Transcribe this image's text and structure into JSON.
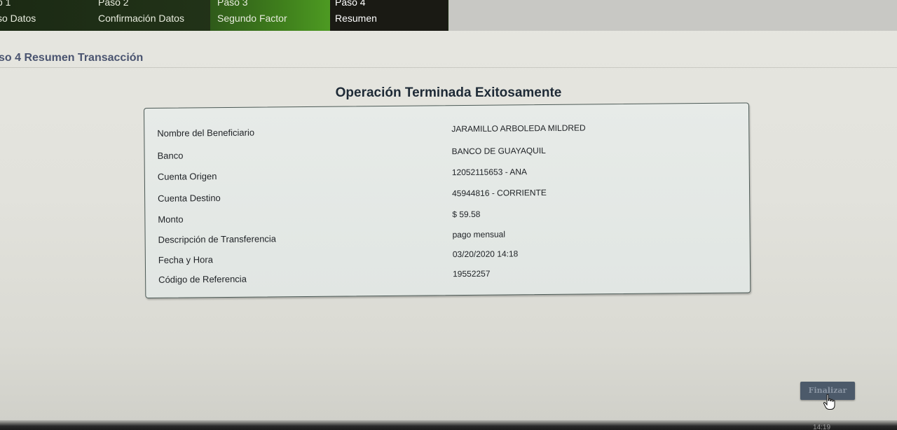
{
  "steps": [
    {
      "num": "o 1",
      "label": "so Datos"
    },
    {
      "num": "Paso 2",
      "label": "Confirmación Datos"
    },
    {
      "num": "Paso 3",
      "label": "Segundo Factor"
    },
    {
      "num": "Paso 4",
      "label": "Resumen"
    }
  ],
  "page_title": "so 4 Resumen Transacción",
  "result_title": "Operación Terminada Exitosamente",
  "details": [
    {
      "label": "Nombre del Beneficiario",
      "value": "JARAMILLO ARBOLEDA MILDRED"
    },
    {
      "label": "Banco",
      "value": "BANCO DE GUAYAQUIL"
    },
    {
      "label": "Cuenta Origen",
      "value": "12052115653 - ANA"
    },
    {
      "label": "Cuenta Destino",
      "value": "45944816 - CORRIENTE"
    },
    {
      "label": "Monto",
      "value": "$ 59.58"
    },
    {
      "label": "Descripción de Transferencia",
      "value": "pago mensual"
    },
    {
      "label": "Fecha y Hora",
      "value": "03/20/2020 14:18"
    },
    {
      "label": "Código de Referencia",
      "value": "19552257"
    }
  ],
  "finalizar_label": "Finalizar",
  "taskbar_clock": "14:19",
  "colors": {
    "active_step_bg": "#1a1a14",
    "completed_step_green": "#4d9a22",
    "title_blue": "#4a5470",
    "button_bg": "#4c5a6a"
  },
  "icons": {
    "cursor": "hand-pointer-icon"
  }
}
